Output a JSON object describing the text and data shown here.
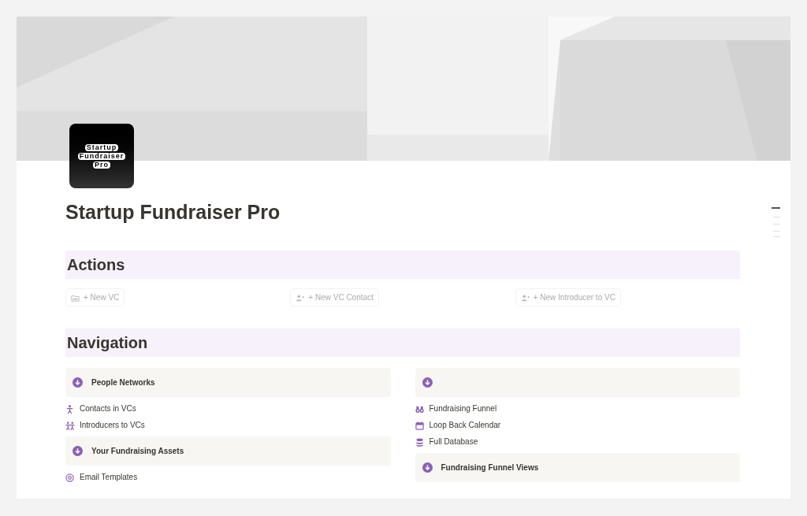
{
  "page_icon": {
    "lines": [
      "Startup",
      "Fundraiser",
      "Pro"
    ]
  },
  "title": "Startup Fundraiser Pro",
  "sections": [
    {
      "heading": "Actions",
      "kind": "buttons",
      "buttons": [
        {
          "label": "+ New VC"
        },
        {
          "label": "+ New VC Contact"
        },
        {
          "label": "+ New Introducer to VC"
        }
      ]
    },
    {
      "heading": "Navigation",
      "kind": "columns",
      "columns": [
        {
          "groups": [
            {
              "title": "People Networks",
              "links": [
                {
                  "label": "Contacts in VCs"
                },
                {
                  "label": "Introducers to VCs"
                }
              ]
            },
            {
              "title": "Your Fundraising Assets",
              "links": [
                {
                  "label": "Email Templates"
                }
              ]
            }
          ]
        },
        {
          "groups": [
            {
              "links": [
                {
                  "label": "Fundraising Funnel"
                },
                {
                  "label": "Loop Back Calendar"
                },
                {
                  "label": "Full Database"
                }
              ]
            },
            {
              "title": "Fundraising Funnel Views"
            }
          ]
        }
      ]
    }
  ]
}
